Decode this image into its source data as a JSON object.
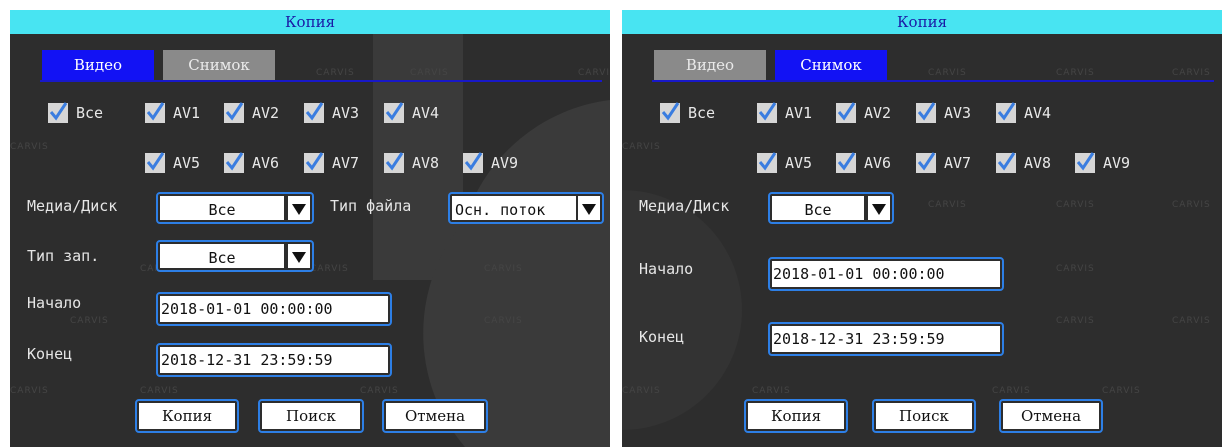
{
  "watermark": "CARVIS",
  "colors": {
    "title_bg": "#48e4f2",
    "title_text": "#1a1aa6",
    "tab_active": "#1212f4",
    "tab_inactive": "#8a8a8a",
    "panel_bg": "#2d2d2d",
    "focus_border": "#2d7fe6",
    "check": "#3a7de0"
  },
  "left": {
    "title": "Копия",
    "tabs": [
      {
        "label": "Видео",
        "active": true
      },
      {
        "label": "Снимок",
        "active": false
      }
    ],
    "checkboxes": {
      "all": "Все",
      "channels": [
        "AV1",
        "AV2",
        "AV3",
        "AV4",
        "AV5",
        "AV6",
        "AV7",
        "AV8",
        "AV9"
      ]
    },
    "media_label": "Медиа/Диск",
    "media_value": "Все",
    "file_type_label": "Тип файла",
    "file_type_value": "Осн. поток",
    "rec_type_label": "Тип зап.",
    "rec_type_value": "Все",
    "start_label": "Начало",
    "start_value": "2018-01-01 00:00:00",
    "end_label": "Конец",
    "end_value": "2018-12-31 23:59:59",
    "buttons": {
      "copy": "Копия",
      "search": "Поиск",
      "cancel": "Отмена"
    }
  },
  "right": {
    "title": "Копия",
    "tabs": [
      {
        "label": "Видео",
        "active": false
      },
      {
        "label": "Снимок",
        "active": true
      }
    ],
    "checkboxes": {
      "all": "Все",
      "channels": [
        "AV1",
        "AV2",
        "AV3",
        "AV4",
        "AV5",
        "AV6",
        "AV7",
        "AV8",
        "AV9"
      ]
    },
    "media_label": "Медиа/Диск",
    "media_value": "Все",
    "start_label": "Начало",
    "start_value": "2018-01-01 00:00:00",
    "end_label": "Конец",
    "end_value": "2018-12-31 23:59:59",
    "buttons": {
      "copy": "Копия",
      "search": "Поиск",
      "cancel": "Отмена"
    }
  }
}
